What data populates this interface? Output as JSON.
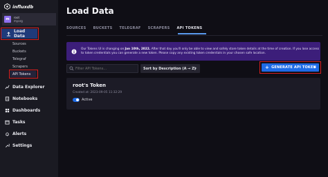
{
  "app": {
    "logo_text": "influxdb"
  },
  "org": {
    "avatar_letter": "m",
    "user": "root",
    "name": "myorg"
  },
  "sidebar": {
    "load_data": "Load Data",
    "sub_items": [
      "Sources",
      "Buckets",
      "Telegraf",
      "Scrapers",
      "API Tokens"
    ],
    "items": [
      "Data Explorer",
      "Notebooks",
      "Dashboards",
      "Tasks",
      "Alerts",
      "Settings"
    ]
  },
  "page": {
    "title": "Load Data"
  },
  "tabs": [
    "SOURCES",
    "BUCKETS",
    "TELEGRAF",
    "SCRAPERS",
    "API TOKENS"
  ],
  "banner": {
    "part1": "Our Tokens UI is changing on ",
    "date": "Jan 10th, 2022.",
    "part2": " After that day you'll only be able to view and safely store token details at the time of creation. If you lose access to token credentials you can generate a new token. Please copy any existing token credentials in your chosen safe location."
  },
  "filter": {
    "placeholder": "Filter API Tokens..."
  },
  "sort": {
    "label": "Sort by Description (A → Z)"
  },
  "generate_button": {
    "label": "GENERATE API TOKEN"
  },
  "token": {
    "name": "root's Token",
    "created": "Created at: 2023-09-05 11:32:29",
    "status": "Active"
  },
  "colors": {
    "accent": "#1e6be6",
    "highlight": "#d91e1e",
    "banner": "#3c1e7a",
    "sidebar_active": "#1f3a7a"
  }
}
